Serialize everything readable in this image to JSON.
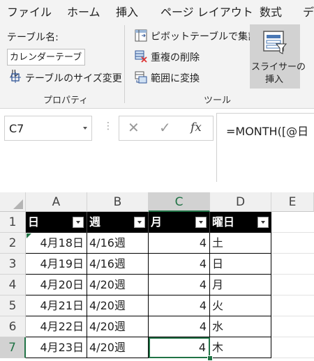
{
  "ribbon_tabs": [
    "ファイル",
    "ホーム",
    "挿入",
    "ページ レイアウト",
    "数式",
    "デ"
  ],
  "properties": {
    "table_name_label": "テーブル名:",
    "table_name_value": "カレンダーテーブル",
    "resize_label": "テーブルのサイズ変更",
    "group_label": "プロパティ"
  },
  "tools": {
    "pivot_label": "ピボットテーブルで集計",
    "remove_dup_label": "重複の削除",
    "convert_label": "範囲に変換",
    "slicer_line1": "スライサーの",
    "slicer_line2": "挿入",
    "group_label": "ツール"
  },
  "formula_bar": {
    "name_box": "C7",
    "fx": "fx",
    "formula": "=MONTH([@日"
  },
  "sheet": {
    "columns": [
      "A",
      "B",
      "C",
      "D",
      "E"
    ],
    "rows": [
      "1",
      "2",
      "3",
      "4",
      "5",
      "6",
      "7"
    ],
    "headers": [
      "日",
      "週",
      "月",
      "曜日"
    ],
    "data": [
      [
        "4月18日",
        "4/16週",
        "4",
        "土"
      ],
      [
        "4月19日",
        "4/16週",
        "4",
        "日"
      ],
      [
        "4月20日",
        "4/20週",
        "4",
        "月"
      ],
      [
        "4月21日",
        "4/20週",
        "4",
        "火"
      ],
      [
        "4月22日",
        "4/20週",
        "4",
        "水"
      ],
      [
        "4月23日",
        "4/20週",
        "4",
        "木"
      ]
    ],
    "selected_cell": "C7"
  },
  "colors": {
    "ribbon_bg": "#f3f3f3",
    "selection": "#217346",
    "header_fill": "#000000"
  }
}
